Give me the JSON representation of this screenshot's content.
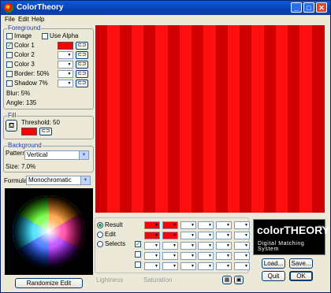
{
  "window": {
    "title": "ColorTheory"
  },
  "menu": [
    "File",
    "Edit",
    "Help"
  ],
  "foreground": {
    "label": "Foreground",
    "image_label": "Image",
    "image_checked": false,
    "use_alpha_label": "Use Alpha",
    "use_alpha_checked": false,
    "rows": [
      {
        "label": "Color 1",
        "checked": true,
        "color": "#ff0000"
      },
      {
        "label": "Color 2",
        "checked": false
      },
      {
        "label": "Color 3",
        "checked": false
      },
      {
        "label": "Border: 50%",
        "checked": false
      },
      {
        "label": "Shadow 7%",
        "checked": false
      }
    ],
    "blur": "Blur: 5%",
    "angle": "Angle: 135"
  },
  "fill": {
    "label": "Fill",
    "threshold": "Threshold: 50",
    "color": "#ff0000"
  },
  "background": {
    "label": "Background",
    "pattern_label": "Pattern",
    "pattern_value": "Vertical",
    "size": "Size: 7.0%"
  },
  "formula": {
    "label": "Formula",
    "value": "Monochromatic"
  },
  "randomize_label": "Randomize Edit",
  "preview": {
    "stripe_dark": "#d00000",
    "stripe_light": "#ff1010",
    "stripe_count": 19
  },
  "modes": [
    {
      "label": "Result",
      "selected": true
    },
    {
      "label": "Edit",
      "selected": false
    },
    {
      "label": "Selects",
      "selected": false
    }
  ],
  "status": {
    "lightness": "Lightness",
    "saturation": "Saturation"
  },
  "logo": {
    "main": "colorTHEORY",
    "tm": "TM",
    "sub": "Digital Matching System"
  },
  "buttons": {
    "load": "Load...",
    "save": "Save...",
    "quit": "Quit",
    "ok": "OK"
  },
  "colors": {
    "accent_red": "#ff0000",
    "title_blue": "#0a3fb0",
    "group_label": "#1c3fb0"
  }
}
